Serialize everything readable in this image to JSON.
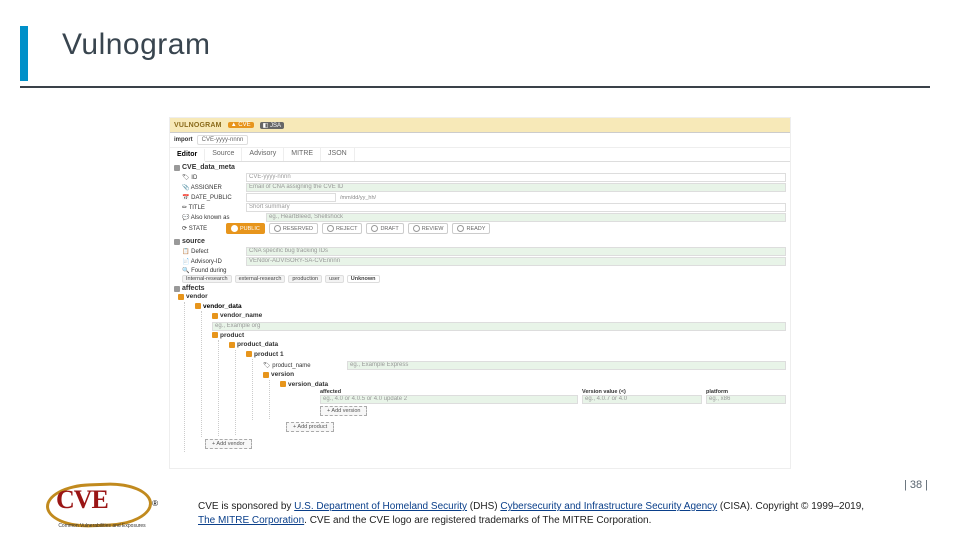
{
  "slide": {
    "title": "Vulnogram",
    "page_number": "| 38 |"
  },
  "topbar": {
    "brand": "VULNOGRAM",
    "cve_btn": "▲ CVE",
    "nvd_btn": "◧ JSA"
  },
  "toolbar": {
    "import_label": "import",
    "placeholder": "CVE-yyyy-nnnn"
  },
  "tabs": {
    "t0": "Editor",
    "t1": "Source",
    "t2": "Advisory",
    "t3": "MITRE",
    "t4": "JSON"
  },
  "meta": {
    "head": "CVE_data_meta",
    "id_label": "🏷 ID",
    "id_ph": "CVE-yyyy-nnnn",
    "assigner_label": "📎 ASSIGNER",
    "assigner_ph": "Email of CNA assigning the CVE ID",
    "date_label": "📅 DATE_PUBLIC",
    "date_format": "/mm/dd/yy_hh/",
    "title_label": "✏ TITLE",
    "title_ph": "Short summary",
    "aka_label": "💬 Also known as",
    "aka_ph": "eg., HeartBleed, Shellshock",
    "state_label": "⟳ STATE"
  },
  "states": {
    "s0": "PUBLIC",
    "s1": "RESERVED",
    "s2": "REJECT",
    "s3": "DRAFT",
    "s4": "REVIEW",
    "s5": "READY"
  },
  "source": {
    "head": "source",
    "defect_label": "📋 Defect",
    "defect_ph": "CNA specific bug tracking IDs",
    "adv_label": "📄 Advisory-ID",
    "adv_ph": "VENdor-ADVISORY-SA-CVEnnnn",
    "found_label": "🔍 Found during"
  },
  "chips": {
    "c0": "Internal-research",
    "c1": "external-research",
    "c2": "production",
    "c3": "user",
    "c4": "Unknown"
  },
  "affects": {
    "head": "affects",
    "vendor": "vendor",
    "vendor_data": "vendor_data",
    "vendor_name": "vendor_name",
    "vendor_ph": "eg., Example org",
    "product": "product",
    "product_data": "product_data",
    "product1": "product 1",
    "pname": "🏷 product_name",
    "pname_ph": "eg., Example Express",
    "version": "version",
    "version_data": "version_data",
    "col1": "affected",
    "col2": "Version value (<)",
    "col3": "platform",
    "a_ph": "eg., 4.0 or 4.0.5 or 4.0 update 2",
    "v_ph": "eg., 4.0.7 or 4.0",
    "p_ph": "eg., x86"
  },
  "buttons": {
    "add_version": "+ Add version",
    "Add_product": "+ Add product",
    "add_vendor": "+ Add vendor"
  },
  "footer": {
    "line1a": "CVE is sponsored by ",
    "link1": "U.S. Department of Homeland Security",
    "line1b": " (DHS) ",
    "link2": "Cybersecurity and Infrastructure Security Agency",
    "line1c": " (CISA). Copyright © 1999–2019, ",
    "link3": "The MITRE Corporation",
    "line2": ". CVE and the CVE logo are registered trademarks of The MITRE Corporation."
  },
  "logo": {
    "text": "CVE",
    "sub": "Common Vulnerabilities and Exposures"
  }
}
